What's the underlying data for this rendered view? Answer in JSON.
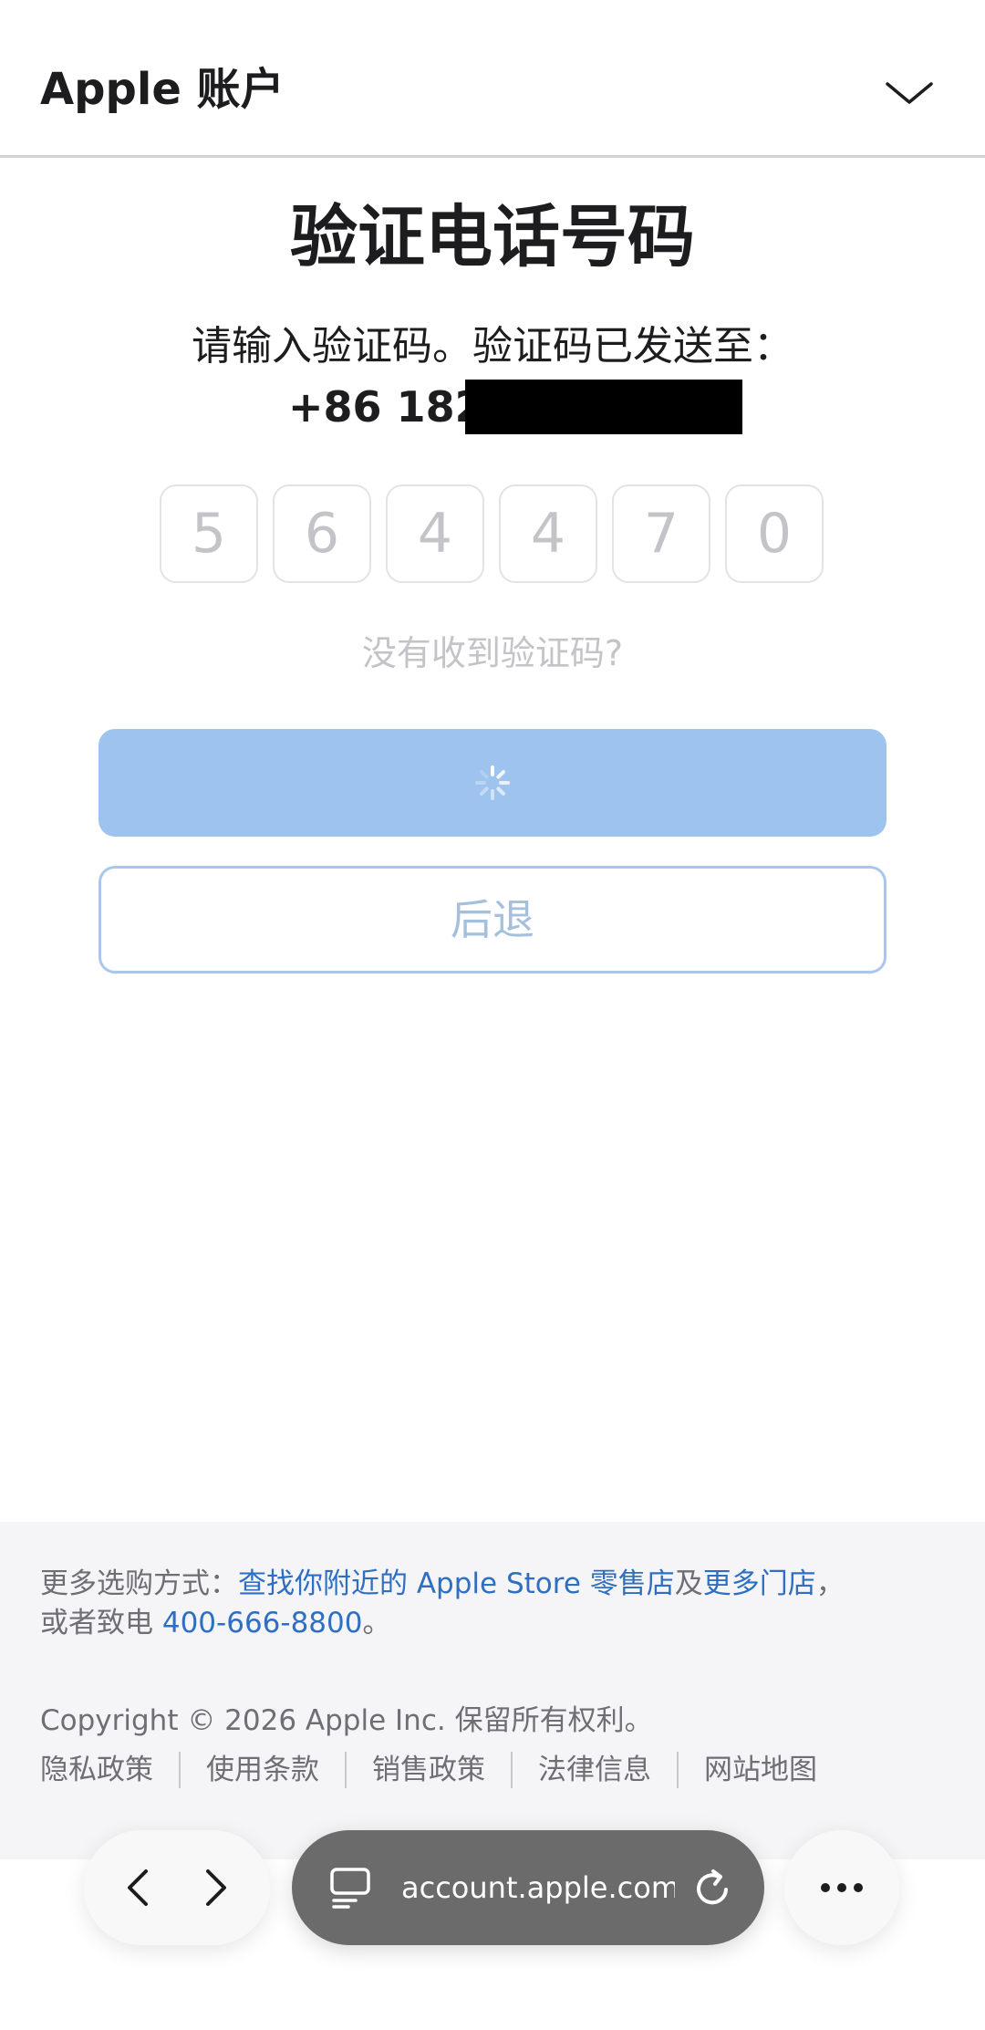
{
  "header": {
    "title": "Apple 账户",
    "chevron_icon": "chevron-down-icon"
  },
  "main": {
    "title": "验证电话号码",
    "subtitle": "请输入验证码。验证码已发送至：",
    "phone_prefix": "+86 182",
    "code_digits": [
      "5",
      "6",
      "4",
      "4",
      "7",
      "0"
    ],
    "resend_link": "没有收到验证码?",
    "submit_state": "loading",
    "back_button": "后退"
  },
  "footer": {
    "more_ways_prefix": "更多选购方式：",
    "find_store_link": "查找你附近的 Apple Store 零售店",
    "and_text": "及",
    "more_stores_link": "更多门店",
    "comma": "，",
    "call_prefix": "或者致电 ",
    "phone_link": "400-666-8800",
    "period": "。",
    "copyright": "Copyright © 2026 Apple Inc. 保留所有权利。",
    "legal_links": [
      "隐私政策",
      "使用条款",
      "销售政策",
      "法律信息",
      "网站地图"
    ]
  },
  "browser": {
    "url": "account.apple.com",
    "icons": [
      "chevron-left-icon",
      "chevron-right-icon",
      "tabs-icon",
      "reload-icon",
      "more-icon"
    ]
  },
  "colors": {
    "accent_blue": "#2f6fc1",
    "button_loading_bg": "#9ec3ee",
    "text_primary": "#1d1d1f",
    "text_muted": "#6e6e73",
    "footer_bg": "#f5f5f7"
  }
}
